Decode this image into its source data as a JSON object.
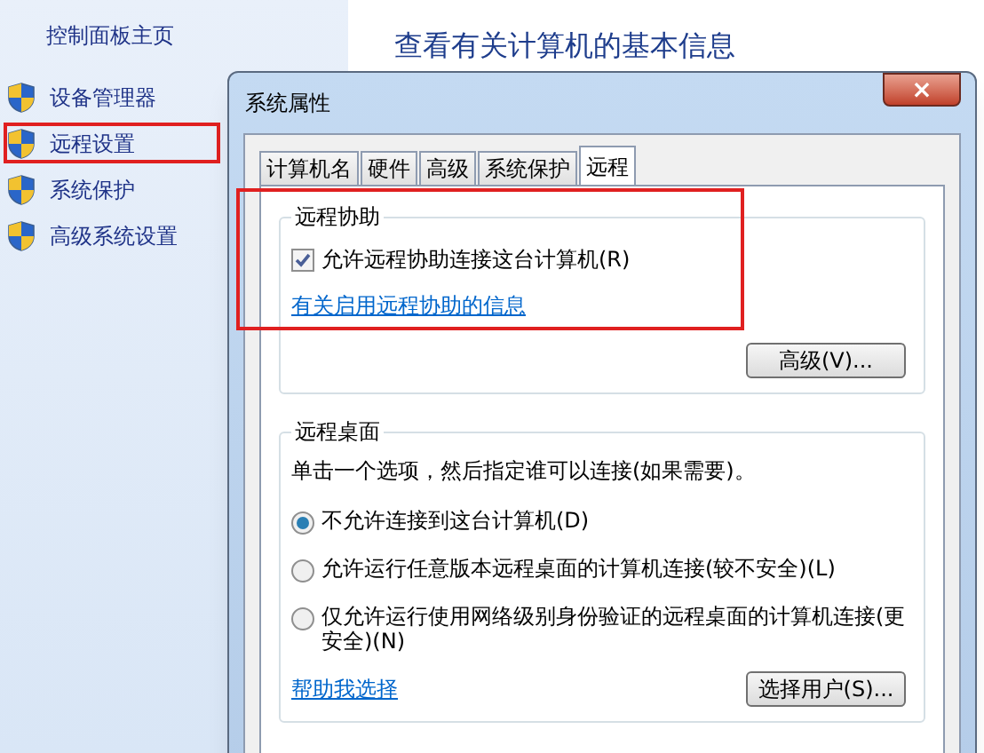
{
  "sidebar": {
    "home": "控制面板主页",
    "items": [
      {
        "label": "设备管理器",
        "highlighted": false
      },
      {
        "label": "远程设置",
        "highlighted": true
      },
      {
        "label": "系统保护",
        "highlighted": false
      },
      {
        "label": "高级系统设置",
        "highlighted": false
      }
    ]
  },
  "page_title": "查看有关计算机的基本信息",
  "dialog": {
    "title": "系统属性",
    "close": "×",
    "tabs": [
      {
        "label": "计算机名",
        "selected": false
      },
      {
        "label": "硬件",
        "selected": false
      },
      {
        "label": "高级",
        "selected": false
      },
      {
        "label": "系统保护",
        "selected": false
      },
      {
        "label": "远程",
        "selected": true
      }
    ],
    "remote_assistance": {
      "title": "远程协助",
      "highlighted": true,
      "checkbox": {
        "label": "允许远程协助连接这台计算机(R)",
        "checked": true
      },
      "link": "有关启用远程协助的信息",
      "button": "高级(V)..."
    },
    "remote_desktop": {
      "title": "远程桌面",
      "hint": "单击一个选项，然后指定谁可以连接(如果需要)。",
      "options": [
        {
          "label": "不允许连接到这台计算机(D)",
          "selected": true
        },
        {
          "label": "允许运行任意版本远程桌面的计算机连接(较不安全)(L)",
          "selected": false
        },
        {
          "label": "仅允许运行使用网络级别身份验证的远程桌面的计算机连接(更安全)(N)",
          "selected": false
        }
      ],
      "link": "帮助我选择",
      "button": "选择用户(S)..."
    }
  }
}
